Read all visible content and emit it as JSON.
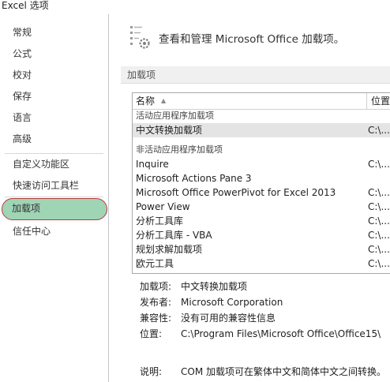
{
  "window": {
    "title": "Excel 选项"
  },
  "sidebar": {
    "items": [
      {
        "label": "常规"
      },
      {
        "label": "公式"
      },
      {
        "label": "校对"
      },
      {
        "label": "保存"
      },
      {
        "label": "语言"
      },
      {
        "label": "高级"
      },
      {
        "label": "自定义功能区"
      },
      {
        "label": "快速访问工具栏"
      },
      {
        "label": "加载项",
        "selected": true
      },
      {
        "label": "信任中心"
      }
    ],
    "highlight_color": "#9fd4b5",
    "annotation_color": "#b83a3a"
  },
  "main": {
    "header_title": "查看和管理 Microsoft Office 加载项。",
    "header_icon": "addin-gear-icon",
    "section_title": "加载项",
    "list": {
      "col_name": "名称",
      "col_location": "位置",
      "active_group": "活动应用程序加载项",
      "active": [
        {
          "name": "中文转换加载项",
          "location": "C:\\..."
        }
      ],
      "inactive_group": "非活动应用程序加载项",
      "inactive": [
        {
          "name": "Inquire",
          "location": "C:\\..."
        },
        {
          "name": "Microsoft Actions Pane 3",
          "location": ""
        },
        {
          "name": "Microsoft Office PowerPivot for Excel 2013",
          "location": "C:\\..."
        },
        {
          "name": "Power View",
          "location": "C:\\..."
        },
        {
          "name": "分析工具库",
          "location": "C:\\..."
        },
        {
          "name": "分析工具库 - VBA",
          "location": "C:\\..."
        },
        {
          "name": "规划求解加载项",
          "location": "C:\\..."
        },
        {
          "name": "欧元工具",
          "location": "C:\\..."
        }
      ]
    },
    "details": {
      "addin_label": "加载项:",
      "addin_value": "中文转换加载项",
      "publisher_label": "发布者:",
      "publisher_value": "Microsoft Corporation",
      "compat_label": "兼容性:",
      "compat_value": "没有可用的兼容性信息",
      "location_label": "位置:",
      "location_value": "C:\\Program Files\\Microsoft Office\\Office15\\",
      "desc_label": "说明:",
      "desc_value": "COM 加载项可在繁体中文和简体中文之间转换。"
    }
  }
}
